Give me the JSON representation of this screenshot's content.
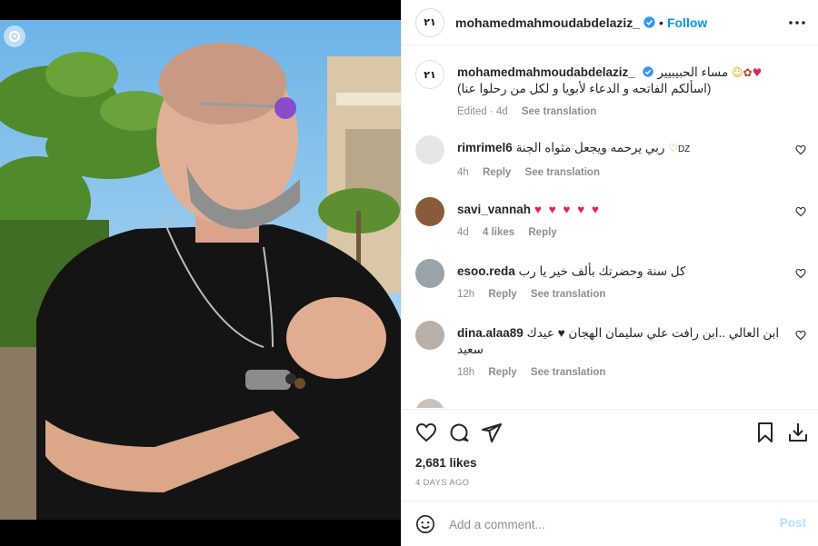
{
  "post": {
    "username": "mohamedmahmoudabdelaziz_",
    "follow_label": "Follow",
    "separator": "•",
    "avatar_logo": "٢١"
  },
  "caption": {
    "username": "mohamedmahmoudabdelaziz_",
    "line1": "مساء الحبيبيير",
    "line2": "(اسألكم الفاتحه و الدعاء لأبويا و لكل من رحلوا عنا)",
    "meta_time": "Edited · 4d",
    "see_translation": "See translation"
  },
  "comments": [
    {
      "username": "rimrimel6",
      "text": "ربي يرحمه ويجعل مثواه الجنة",
      "flag": "DZ",
      "time": "4h",
      "reply_label": "Reply",
      "translation_label": "See translation"
    },
    {
      "username": "savi_vannah",
      "text": "♥ ♥ ♥ ♥ ♥",
      "time": "4d",
      "likes_label": "4 likes",
      "reply_label": "Reply"
    },
    {
      "username": "esoo.reda",
      "text": "كل سنة وحضرتك بألف خير يا رب",
      "time": "12h",
      "reply_label": "Reply",
      "translation_label": "See translation"
    },
    {
      "username": "dina.alaa89",
      "text": "ابن العالي ..ابن رافت علي سليمان الهجان ♥ عيدك سعيد",
      "time": "18h",
      "reply_label": "Reply",
      "translation_label": "See translation"
    }
  ],
  "footer": {
    "likes": "2,681 likes",
    "posted_ago": "4 DAYS AGO",
    "comment_placeholder": "Add a comment...",
    "post_label": "Post"
  },
  "colors": {
    "accent": "#0095f6",
    "verified": "#3897f0",
    "muted": "#8e8e8e",
    "post_disabled": "#b2dffc"
  },
  "icons": [
    "carousel-icon",
    "verified-icon",
    "more-icon",
    "heart-icon",
    "comment-icon",
    "share-icon",
    "bookmark-icon",
    "download-icon",
    "emoji-icon"
  ]
}
